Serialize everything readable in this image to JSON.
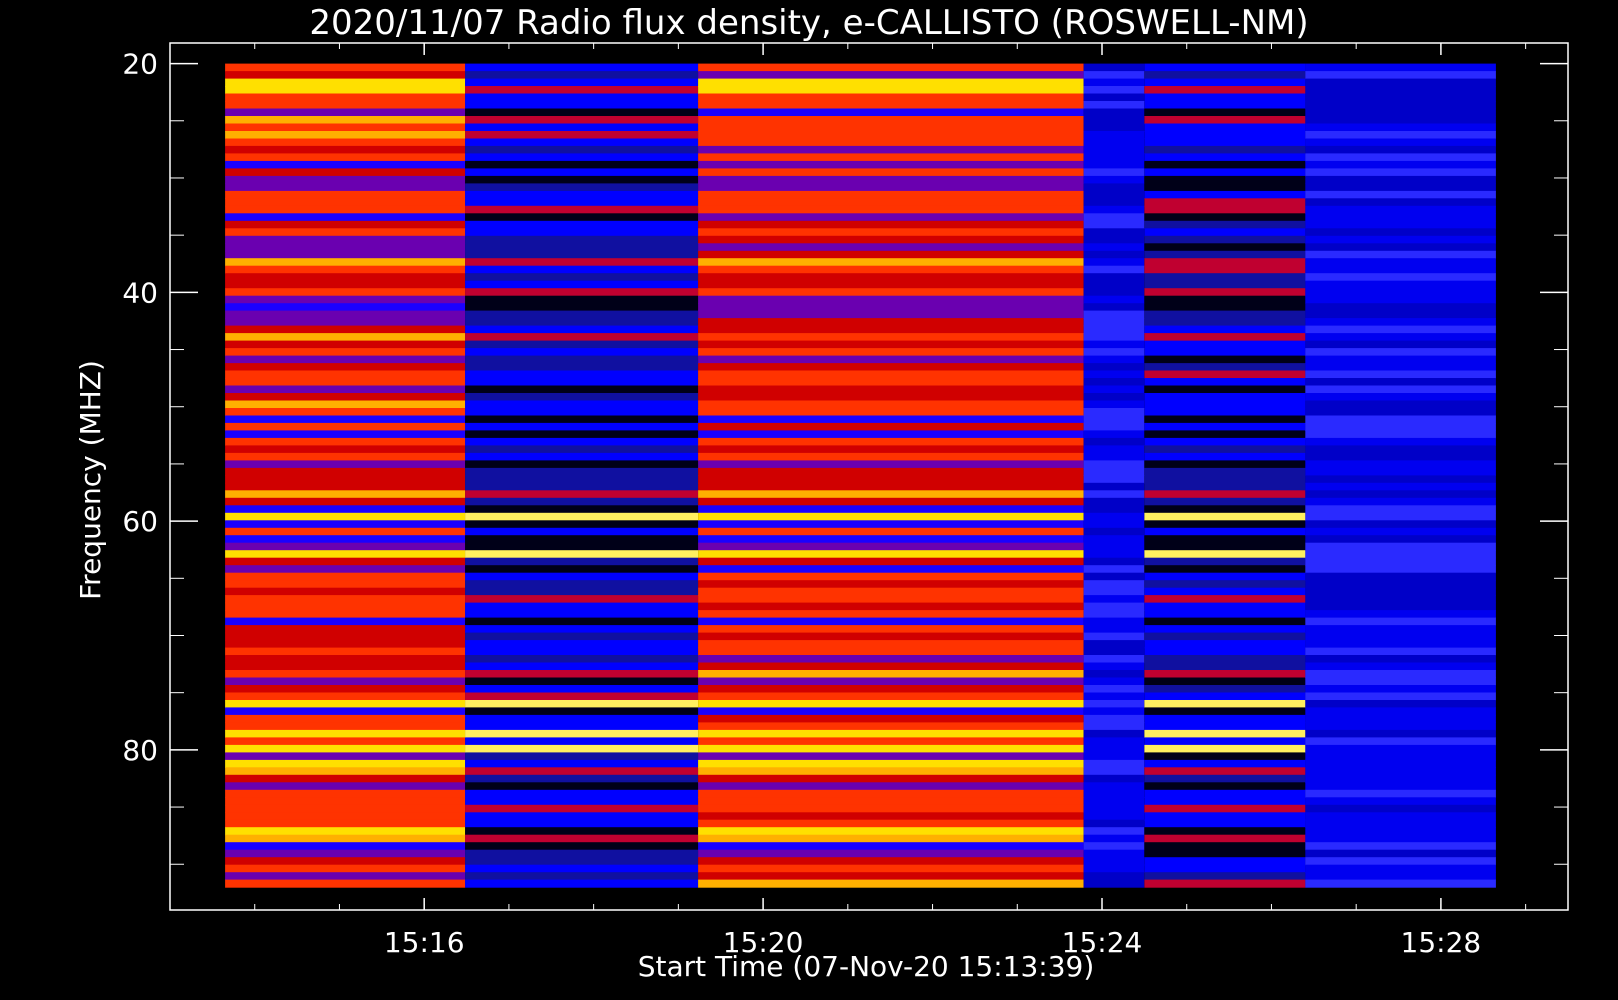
{
  "chart_data": {
    "type": "heatmap",
    "title": "2020/11/07  Radio flux density, e-CALLISTO (ROSWELL-NM)",
    "xlabel": "Start Time (07-Nov-20 15:13:39)",
    "ylabel": "Frequency (MHZ)",
    "x_ticks": [
      "15:16",
      "15:20",
      "15:24",
      "15:28"
    ],
    "x_tick_values": [
      "15:16",
      "15:20",
      "15:24",
      "15:28"
    ],
    "y_ticks": [
      20,
      40,
      60,
      80
    ],
    "xlim": [
      "15:13:00",
      "15:29:30"
    ],
    "ylim": [
      18.2,
      94.0
    ],
    "y_inverted": true,
    "data_time_range": [
      "15:13:39",
      "15:28:39"
    ],
    "data_freq_range": [
      20,
      92
    ],
    "colormap": [
      "#000000",
      "#0000ff",
      "#7a00a0",
      "#ff0000",
      "#ff8000",
      "#ffff00",
      "#ffffff"
    ],
    "segments": [
      {
        "start": "15:13:39",
        "end": "15:16:29",
        "level": "high"
      },
      {
        "start": "15:16:29",
        "end": "15:19:14",
        "level": "low"
      },
      {
        "start": "15:19:14",
        "end": "15:23:47",
        "level": "high"
      },
      {
        "start": "15:23:47",
        "end": "15:24:30",
        "level": "noise"
      },
      {
        "start": "15:24:30",
        "end": "15:26:24",
        "level": "low"
      },
      {
        "start": "15:26:24",
        "end": "15:28:39",
        "level": "noise"
      }
    ],
    "bright_lines_mhz": [
      22,
      59.5,
      63,
      76,
      78.5,
      80,
      81,
      87
    ],
    "grid": false,
    "legend": "none"
  }
}
